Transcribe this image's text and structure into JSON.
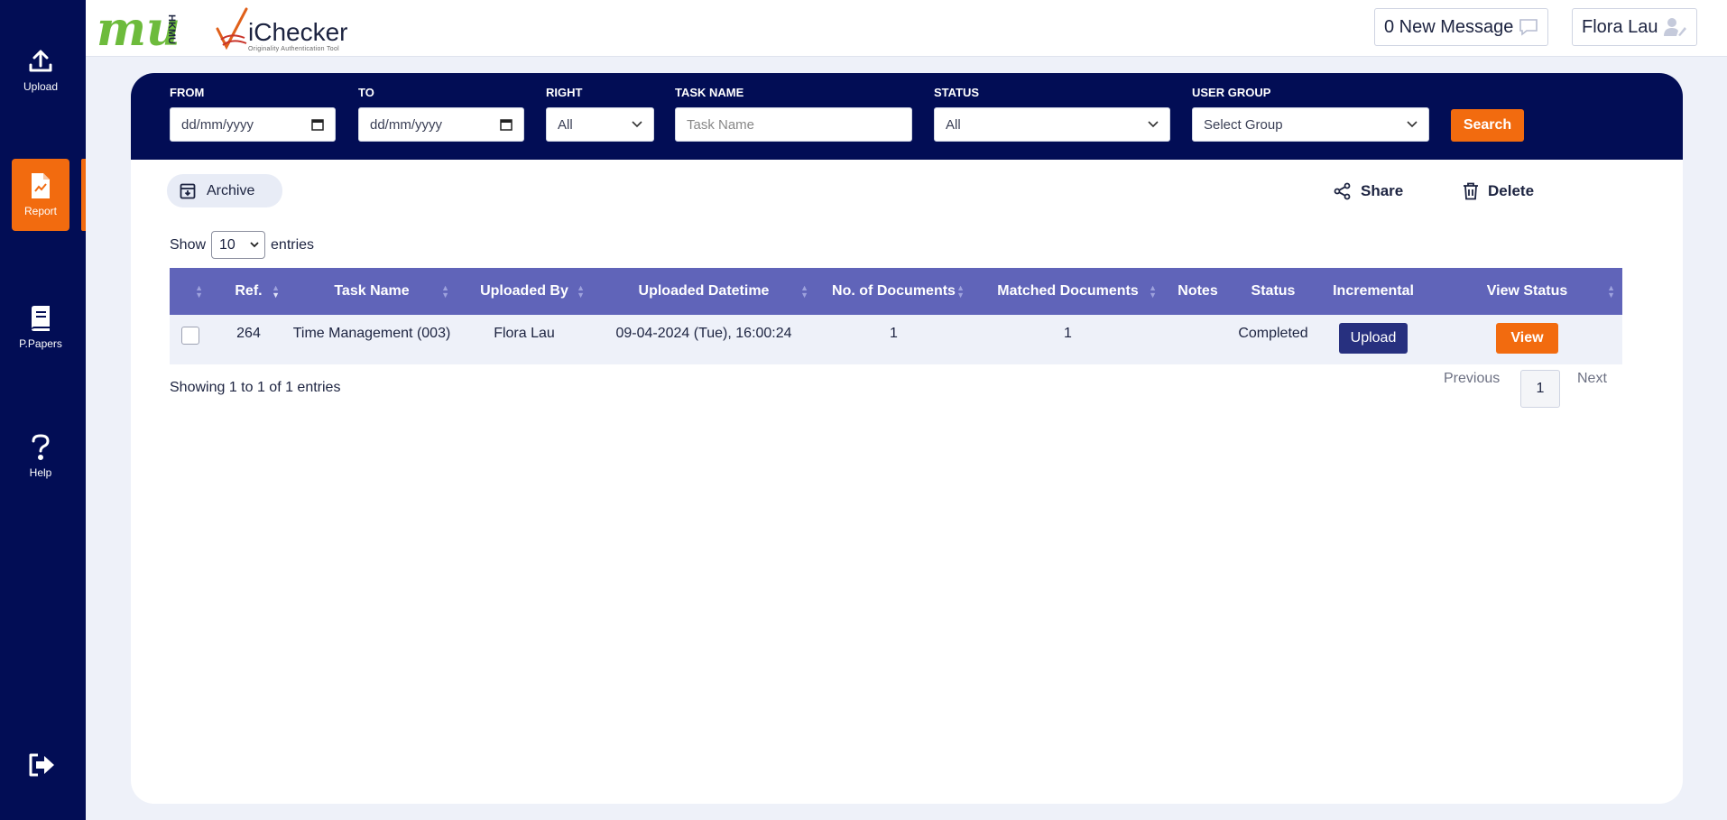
{
  "sidebar": {
    "items": [
      {
        "label": "Upload",
        "icon": "upload-icon"
      },
      {
        "label": "Report",
        "icon": "report-icon",
        "active": true
      },
      {
        "label": "P.Papers",
        "icon": "book-icon"
      },
      {
        "label": "Help",
        "icon": "question-icon"
      }
    ],
    "logout_icon": "logout-icon"
  },
  "header": {
    "brand_mu": "mu",
    "brand_hkmu": "HKMU",
    "app_name": "iChecker",
    "app_tagline": "Originality Authentication Tool",
    "messages_label": "0 New Message",
    "user_name": "Flora Lau"
  },
  "filters": {
    "from_label": "FROM",
    "from_placeholder": "dd/mm/yyyy",
    "to_label": "TO",
    "to_placeholder": "dd/mm/yyyy",
    "right_label": "RIGHT",
    "right_value": "All",
    "task_name_label": "TASK NAME",
    "task_name_placeholder": "Task Name",
    "status_label": "STATUS",
    "status_value": "All",
    "user_group_label": "USER GROUP",
    "user_group_value": "Select Group",
    "search_label": "Search"
  },
  "actions": {
    "archive": "Archive",
    "share": "Share",
    "delete": "Delete"
  },
  "entries": {
    "show": "Show",
    "value": "10",
    "suffix": "entries"
  },
  "table": {
    "columns": [
      "Ref.",
      "Task Name",
      "Uploaded By",
      "Uploaded Datetime",
      "No. of Documents",
      "Matched Documents",
      "Notes",
      "Status",
      "Incremental",
      "View Status"
    ],
    "rows": [
      {
        "ref": "264",
        "task_name": "Time Management (003)",
        "uploaded_by": "Flora Lau",
        "uploaded_datetime": "09-04-2024 (Tue), 16:00:24",
        "no_documents": "1",
        "matched_documents": "1",
        "notes": "",
        "status": "Completed",
        "incremental_label": "Upload",
        "view_label": "View"
      }
    ]
  },
  "pagination": {
    "showing": "Showing 1 to 1 of 1 entries",
    "previous": "Previous",
    "page": "1",
    "next": "Next"
  },
  "colors": {
    "navy": "#020d55",
    "orange": "#f26b0f",
    "table_header": "#6064b9",
    "upload_button": "#27307f"
  }
}
